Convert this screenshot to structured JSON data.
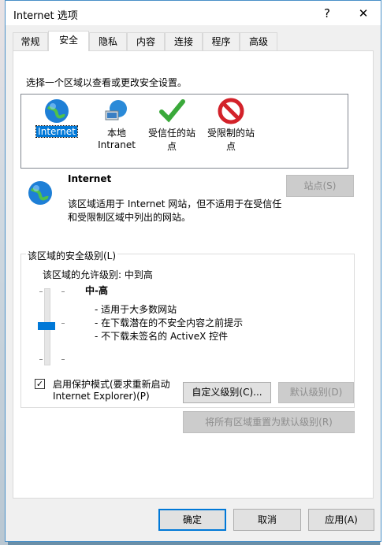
{
  "window": {
    "title": "Internet 选项",
    "help_label": "?",
    "close_label": "✕"
  },
  "tabs": [
    "常规",
    "安全",
    "隐私",
    "内容",
    "连接",
    "程序",
    "高级"
  ],
  "active_tab": "安全",
  "zones_prompt": "选择一个区域以查看或更改安全设置。",
  "zones": [
    {
      "line1": "Internet",
      "line2": "",
      "icon": "globe-icon",
      "selected": true
    },
    {
      "line1": "本地",
      "line2": "Intranet",
      "icon": "intranet-icon",
      "selected": false
    },
    {
      "line1": "受信任的站",
      "line2": "点",
      "icon": "checkmark-icon",
      "selected": false
    },
    {
      "line1": "受限制的站",
      "line2": "点",
      "icon": "restricted-icon",
      "selected": false
    }
  ],
  "zone_detail": {
    "name": "Internet",
    "desc_line1": "该区域适用于 Internet 网站，但不适用于在受信任",
    "desc_line2": "和受限制区域中列出的网站。",
    "sites_button": "站点(S)"
  },
  "security_level": {
    "group_label": "该区域的安全级别(L)",
    "allowed": "该区域的允许级别: 中到高",
    "level_name": "中-高",
    "bullets": [
      "- 适用于大多数网站",
      "- 在下载潜在的不安全内容之前提示",
      "- 不下载未签名的 ActiveX 控件"
    ],
    "level_fraction": 0.5
  },
  "protected_mode": {
    "checked": true,
    "line1": "启用保护模式(要求重新启动",
    "line2": "Internet Explorer)(P)"
  },
  "buttons": {
    "custom_level": "自定义级别(C)...",
    "default_level": "默认级别(D)",
    "reset_all": "将所有区域重置为默认级别(R)",
    "ok": "确定",
    "cancel": "取消",
    "apply": "应用(A)"
  },
  "colors": {
    "accent": "#0078d7",
    "window_border": "#4a90c8"
  }
}
